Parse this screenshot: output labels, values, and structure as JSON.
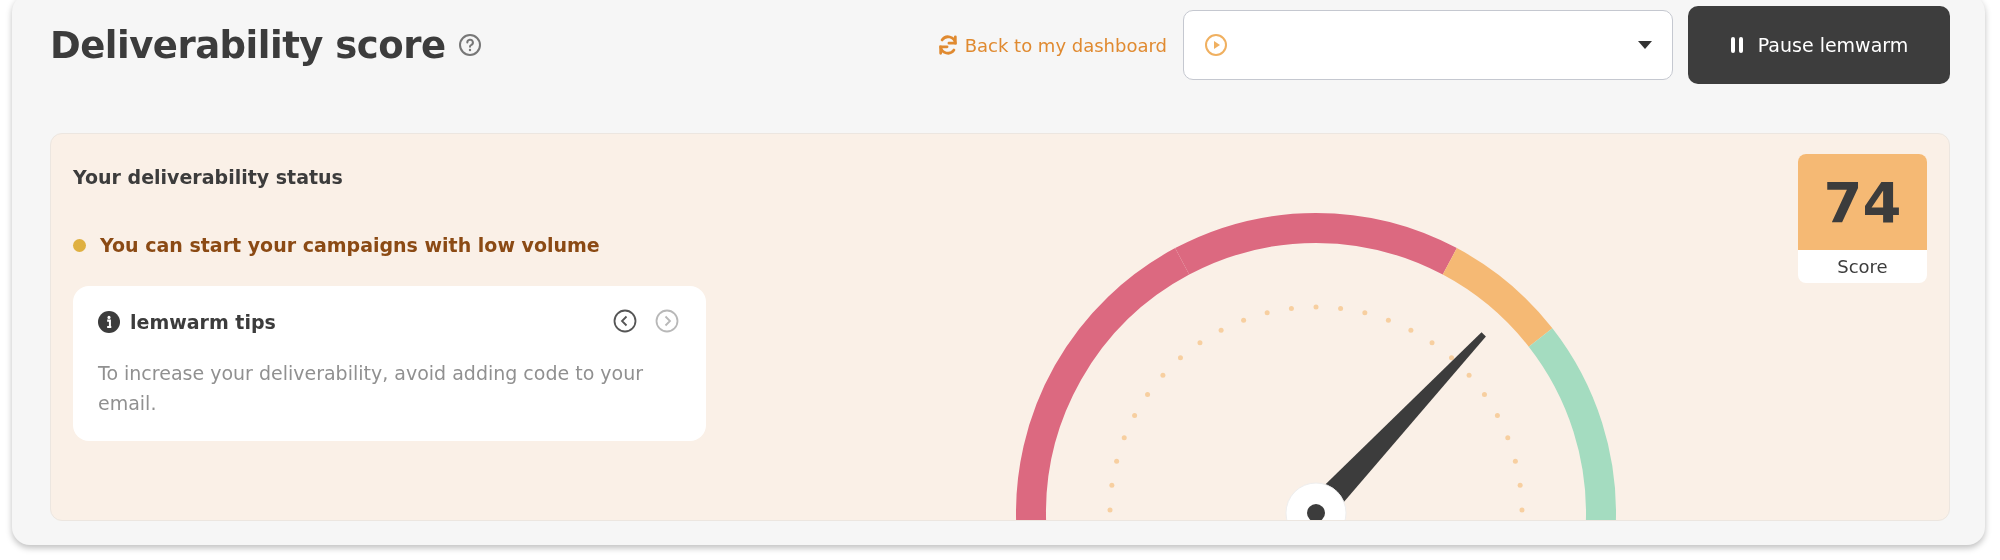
{
  "header": {
    "title": "Deliverability score",
    "back_link": "Back to my dashboard",
    "pause_button": "Pause lemwarm"
  },
  "status": {
    "heading": "Your deliverability status",
    "message": "You can start your campaigns with low volume",
    "color": "#dfb040"
  },
  "tips": {
    "title": "lemwarm tips",
    "text": "To increase your deliverability, avoid adding code to your email.",
    "prev_disabled": false,
    "next_disabled": true
  },
  "score": {
    "value": "74",
    "label": "Score"
  }
}
